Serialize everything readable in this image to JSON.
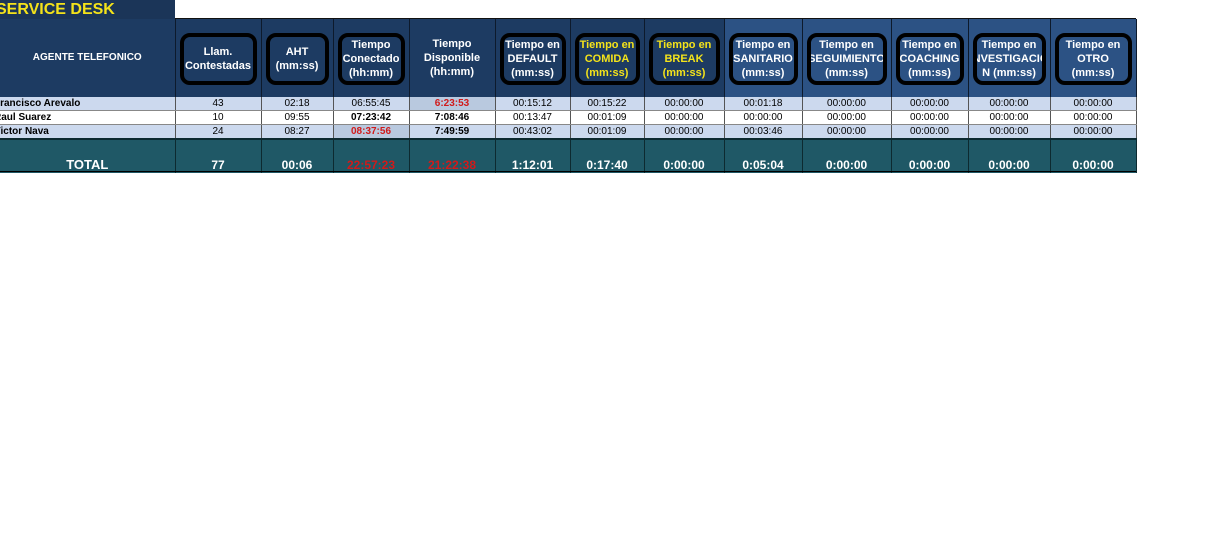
{
  "title": "SERVICE DESK",
  "columns": [
    "AGENTE TELEFONICO",
    "Llam.\nContestadas",
    "AHT\n(mm:ss)",
    "Tiempo\nConectado\n(hh:mm)",
    "Tiempo\nDisponible\n(hh:mm)",
    "Tiempo en\nDEFAULT\n(mm:ss)",
    "Tiempo en\nCOMIDA\n(mm:ss)",
    "Tiempo en\nBREAK\n(mm:ss)",
    "Tiempo en\nSANITARIO\n(mm:ss)",
    "Tiempo en\nSEGUIMIENTO\n(mm:ss)",
    "Tiempo en\nCOACHING\n(mm:ss)",
    "Tiempo en\nINVESTIGACIO\nN (mm:ss)",
    "Tiempo en\nOTRO\n(mm:ss)"
  ],
  "rows": [
    [
      "Francisco Arevalo",
      "43",
      "02:18",
      "06:55:45",
      "6:23:53",
      "00:15:12",
      "00:15:22",
      "00:00:00",
      "00:01:18",
      "00:00:00",
      "00:00:00",
      "00:00:00",
      "00:00:00"
    ],
    [
      "Raul Suarez",
      "10",
      "09:55",
      "07:23:42",
      "7:08:46",
      "00:13:47",
      "00:01:09",
      "00:00:00",
      "00:00:00",
      "00:00:00",
      "00:00:00",
      "00:00:00",
      "00:00:00"
    ],
    [
      "Victor Nava",
      "24",
      "08:27",
      "08:37:56",
      "7:49:59",
      "00:43:02",
      "00:01:09",
      "00:00:00",
      "00:03:46",
      "00:00:00",
      "00:00:00",
      "00:00:00",
      "00:00:00"
    ]
  ],
  "total": [
    "TOTAL",
    "77",
    "00:06",
    "22:57:23",
    "21:22:38",
    "1:12:01",
    "0:17:40",
    "0:00:00",
    "0:05:04",
    "0:00:00",
    "0:00:00",
    "0:00:00",
    "0:00:00"
  ],
  "colors": {
    "header_dark": "#1d3b62",
    "header_light": "#2c5284",
    "highlight_yellow": "#f4e31a",
    "row_alt": "#ccd9ee",
    "total_bg": "#1f5866",
    "alert_red": "#d11a1a"
  }
}
